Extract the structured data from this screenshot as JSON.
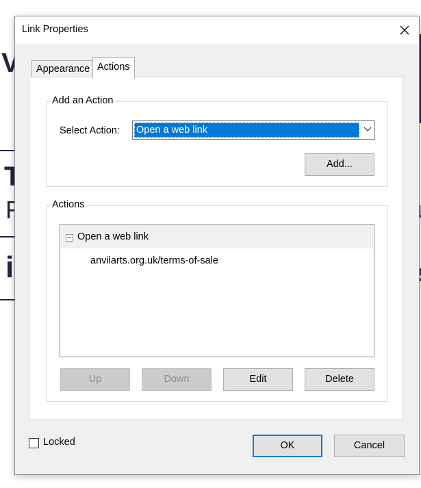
{
  "dialog": {
    "title": "Link Properties",
    "close_glyph": "✕"
  },
  "tabs": [
    {
      "label": "Appearance",
      "active": false
    },
    {
      "label": "Actions",
      "active": true
    }
  ],
  "add_action": {
    "group_title": "Add an Action",
    "select_label": "Select Action:",
    "selected_value": "Open a web link",
    "add_button": "Add..."
  },
  "actions": {
    "group_title": "Actions",
    "tree": {
      "node_label": "Open a web link",
      "child": "anvilarts.org.uk/terms-of-sale"
    },
    "buttons": {
      "up": "Up",
      "down": "Down",
      "edit": "Edit",
      "delete": "Delete"
    }
  },
  "footer": {
    "locked_label": "Locked",
    "locked_checked": false,
    "ok": "OK",
    "cancel": "Cancel"
  },
  "background_glyphs": {
    "top_left": "V",
    "mid_left_1": "T",
    "mid_left_2": "F",
    "bottom_left": "i",
    "right_1": "u",
    "right_2": "s"
  },
  "colors": {
    "accent": "#0078d7",
    "dialog_bg": "#f0f0f0",
    "background_text": "#2b2140"
  }
}
